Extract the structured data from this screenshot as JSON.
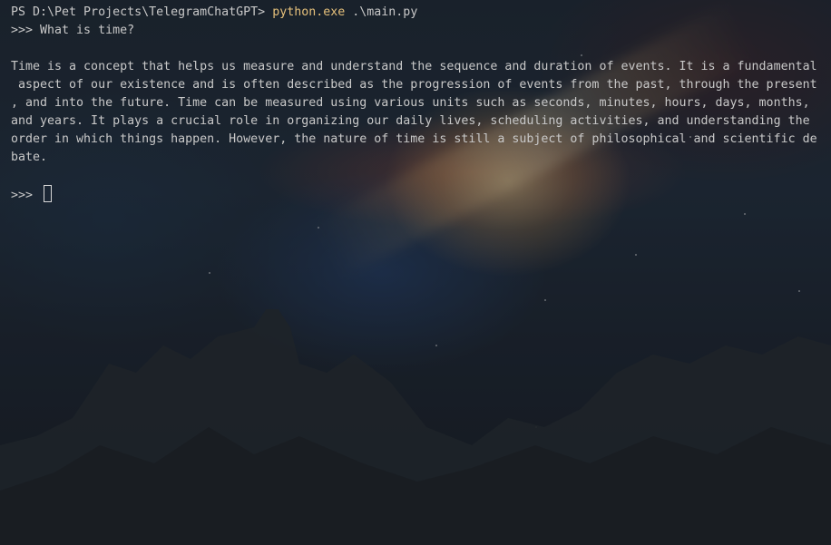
{
  "terminal": {
    "prompt_line": {
      "ps_prompt": "PS D:\\Pet Projects\\TelegramChatGPT> ",
      "command": "python.exe",
      "argument": " .\\main.py"
    },
    "question_line": ">>> What is time?",
    "answer_lines": [
      "Time is a concept that helps us measure and understand the sequence and duration of events. It is a fundamental",
      " aspect of our existence and is often described as the progression of events from the past, through the present",
      ", and into the future. Time can be measured using various units such as seconds, minutes, hours, days, months,",
      "and years. It plays a crucial role in organizing our daily lives, scheduling activities, and understanding the",
      "order in which things happen. However, the nature of time is still a subject of philosophical and scientific de",
      "bate."
    ],
    "input_prompt": ">>> ",
    "colors": {
      "text": "#c8c8c8",
      "command": "#e5c07b",
      "background": "#1a1f26"
    }
  }
}
